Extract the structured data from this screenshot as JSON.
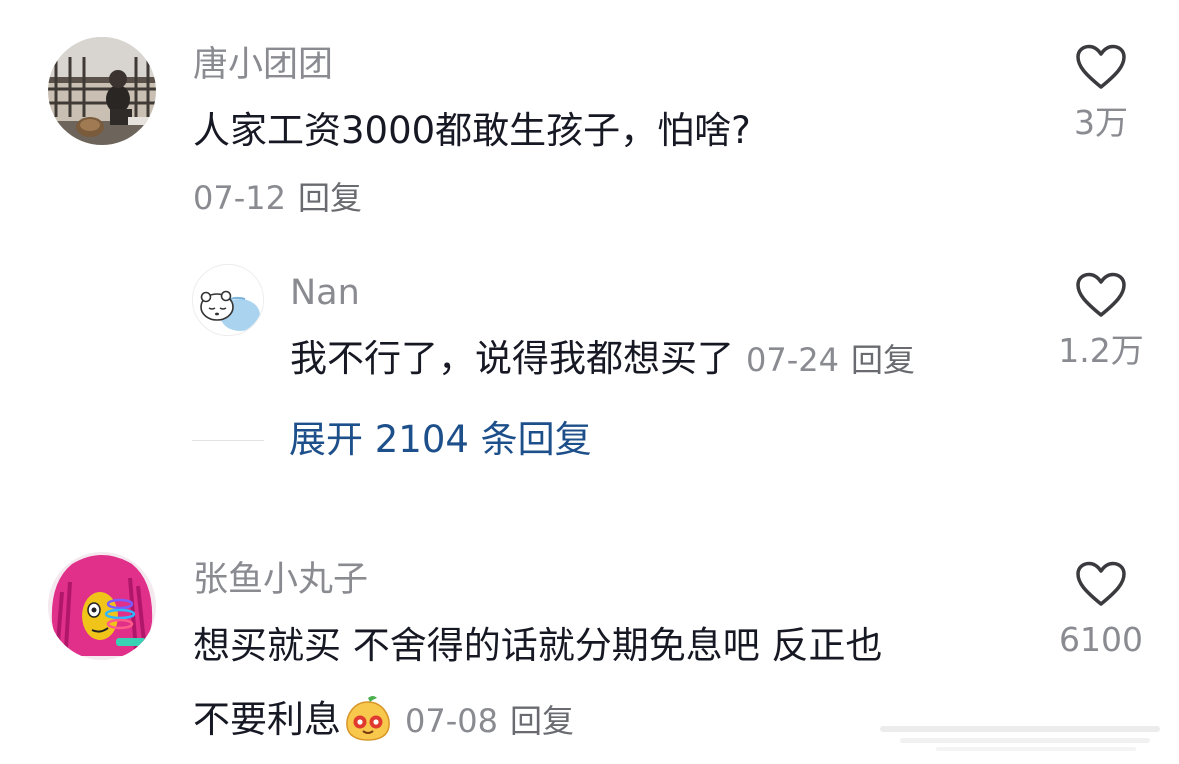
{
  "comments": [
    {
      "username": "唐小团团",
      "text": "人家工资3000都敢生孩子，怕啥?",
      "date": "07-12",
      "reply_label": "回复",
      "likes": "3万",
      "avatar_icon": "photo-avatar"
    },
    {
      "username": "Nan",
      "text": "我不行了，说得我都想买了",
      "date": "07-24",
      "reply_label": "回复",
      "likes": "1.2万",
      "avatar_icon": "sleeping-bear-avatar"
    },
    {
      "username": "张鱼小丸子",
      "text_line1": "想买就买  不舍得的话就分期免息吧  反正也",
      "text_line2": "不要利息",
      "date": "07-08",
      "reply_label": "回复",
      "likes": "6100",
      "avatar_icon": "pink-hair-avatar",
      "emoji_icon": "smiling-pear-emoji"
    }
  ],
  "expand_replies": "展开 2104 条回复",
  "colors": {
    "name_gray": "#8a8b91",
    "text": "#161823",
    "link_blue": "#1d4f8a"
  }
}
